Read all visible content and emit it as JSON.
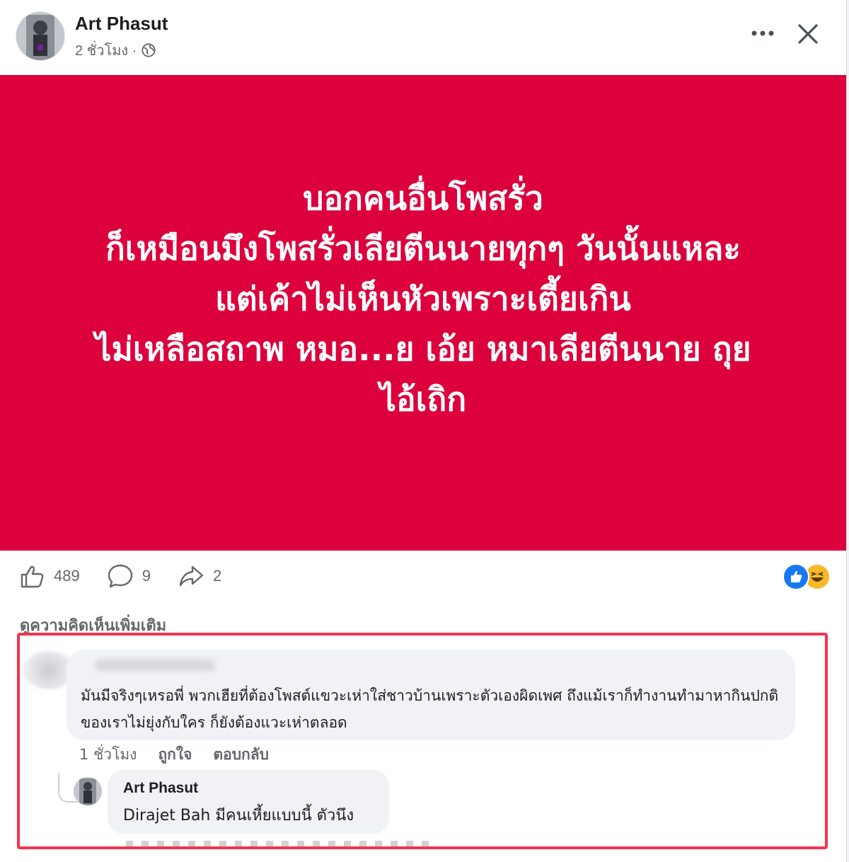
{
  "post": {
    "author": "Art Phasut",
    "time": "2 ชั่วโมง ·",
    "banner_color": "#dc003c",
    "banner_lines": [
      "บอกคนอื่นโพสรั่ว",
      "ก็เหมือนมึงโพสรั่วเลียตีนนายทุกๆ วันนั้นแหละ",
      "แต่เค้าไม่เห็นหัวเพราะเตี้ยเกิน",
      "ไม่เหลือสถาพ หมอ...ย เอ้ย หมาเลียตีนนาย ถุย",
      "ไอ้เถิก"
    ]
  },
  "header_icons": {
    "more": "more-options-icon",
    "close": "close-icon"
  },
  "actions": {
    "like_count": "489",
    "comment_count": "9",
    "share_count": "2"
  },
  "reactions": [
    "like-reaction-icon",
    "haha-reaction-icon"
  ],
  "comments": {
    "more_label": "ดูความคิดเห็นเพิ่มเติม",
    "highlight_color": "#f0344f",
    "first": {
      "text": "มันมีจริงๆเหรอพี่ พวกเฮียที่ต้องโพสต์แขวะเห่าใส่ชาวบ้านเพราะตัวเองผิดเพศ ถึงแม้เราก็ทำงานทำมาหากินปกติของเราไม่ยุ่งกับใคร ก็ยังต้องแวะเห่าตลอด",
      "time": "1 ชั่วโมง",
      "like_label": "ถูกใจ",
      "reply_label": "ตอบกลับ"
    },
    "reply": {
      "author": "Art Phasut",
      "mention": "Dirajet Bah",
      "text": " มีคนเหี้ยแบบนี้ ตัวนึง"
    }
  }
}
